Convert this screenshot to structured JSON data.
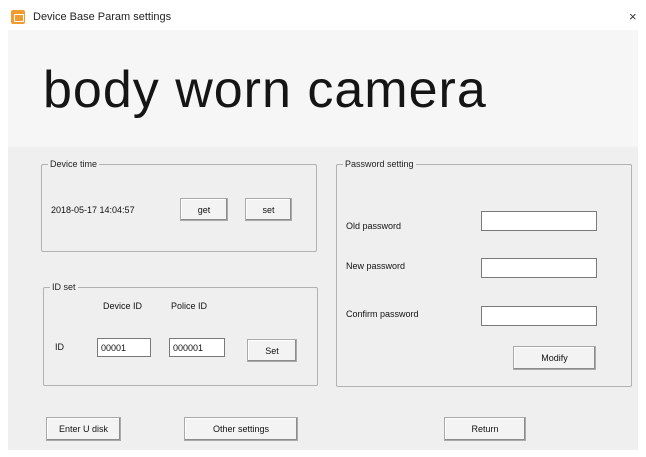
{
  "window": {
    "title": "Device Base Param settings",
    "close_symbol": "×"
  },
  "banner": {
    "text": "body worn camera"
  },
  "device_time": {
    "legend": "Device time",
    "value": "2018-05-17 14:04:57",
    "get_label": "get",
    "set_label": "set"
  },
  "id_set": {
    "legend": "ID set",
    "device_id_header": "Device ID",
    "police_id_header": "Police ID",
    "row_label": "ID",
    "device_id_value": "00001",
    "police_id_value": "000001",
    "set_label": "Set"
  },
  "password": {
    "legend": "Password setting",
    "old_label": "Old password",
    "new_label": "New password",
    "confirm_label": "Confirm password",
    "old_value": "",
    "new_value": "",
    "confirm_value": "",
    "modify_label": "Modify"
  },
  "footer": {
    "enter_udisk_label": "Enter U disk",
    "other_settings_label": "Other settings",
    "return_label": "Return"
  }
}
